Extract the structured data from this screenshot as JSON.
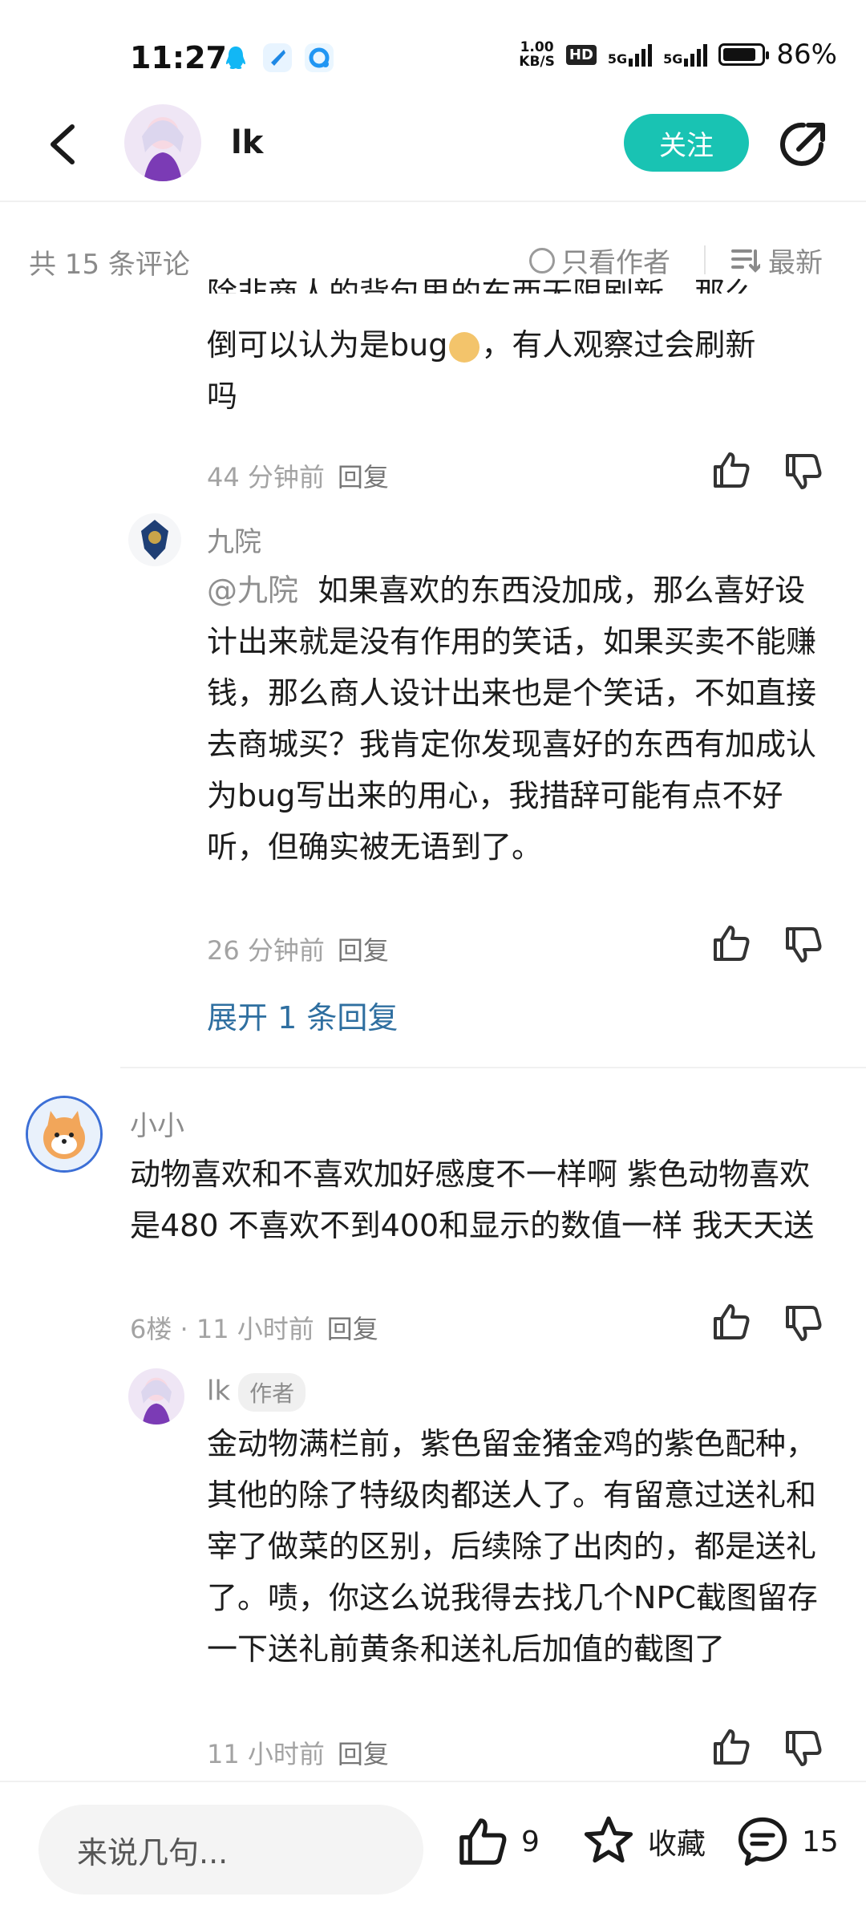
{
  "status_bar": {
    "time": "11:27",
    "net_speed_value": "1.00",
    "net_speed_unit": "KB/S",
    "hd_label": "HD",
    "signal1_label": "5G",
    "signal2_label": "5G",
    "battery_percent": "86%",
    "battery_level": 0.86,
    "app_icons": [
      "qq-icon",
      "message-app-icon",
      "browser-app-icon"
    ]
  },
  "header": {
    "user_name": "lk",
    "follow_label": "关注"
  },
  "comments_toolbar": {
    "count_label": "共 15 条评论",
    "only_author_label": "只看作者",
    "sort_label": "最新"
  },
  "comments": {
    "partial_reply": {
      "text_lines": [
        "除非商人的背包里的东西无限刷新，那么",
        "倒可以认为是bug",
        "，有人观察过会刷新",
        "吗"
      ],
      "time": "44 分钟前",
      "reply_label": "回复"
    },
    "reply_jiuyuan": {
      "user": "九院",
      "mention": "@九院",
      "text": "如果喜欢的东西没加成，那么喜好设计出来就是没有作用的笑话，如果买卖不能赚钱，那么商人设计出来也是个笑话，不如直接去商城买？我肯定你发现喜好的东西有加成认为bug写出来的用心，我措辞可能有点不好听，但确实被无语到了。",
      "time": "26 分钟前",
      "reply_label": "回复"
    },
    "expand_label": "展开 1 条回复",
    "comment_xiaoxiao": {
      "user": "小小",
      "text": "动物喜欢和不喜欢加好感度不一样啊 紫色动物喜欢是480 不喜欢不到400和显示的数值一样 我天天送",
      "floor_time": "6楼 · 11 小时前",
      "reply_label": "回复"
    },
    "reply_lk": {
      "user": "lk",
      "badge": "作者",
      "text": "金动物满栏前，紫色留金猪金鸡的紫色配种，其他的除了特级肉都送人了。有留意过送礼和宰了做菜的区别，后续除了出肉的，都是送礼了。啧，你这么说我得去找几个NPC截图留存一下送礼前黄条和送礼后加值的截图了",
      "time": "11 小时前",
      "reply_label": "回复"
    }
  },
  "bottom_bar": {
    "input_placeholder": "来说几句...",
    "like_count": "9",
    "favorite_label": "收藏",
    "comment_count": "15"
  },
  "colors": {
    "accent": "#19c3b3",
    "link": "#2f6fa0",
    "meta": "#a3a3a3"
  }
}
